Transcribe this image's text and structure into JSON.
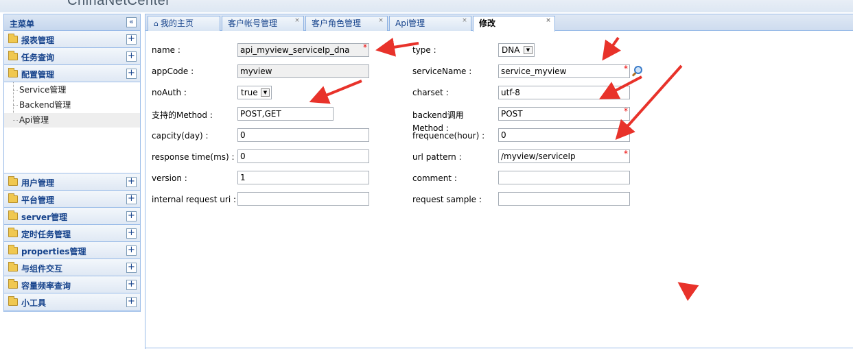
{
  "brand": "ChinaNetCenter",
  "sidebar": {
    "title": "主菜单",
    "collapse_glyph": "«",
    "groups_top": [
      {
        "label": "报表管理"
      },
      {
        "label": "任务查询"
      },
      {
        "label": "配置管理"
      }
    ],
    "sub_items": [
      {
        "label": "Service管理"
      },
      {
        "label": "Backend管理"
      },
      {
        "label": "Api管理"
      }
    ],
    "groups_bottom": [
      {
        "label": "用户管理"
      },
      {
        "label": "平台管理"
      },
      {
        "label": "server管理"
      },
      {
        "label": "定时任务管理"
      },
      {
        "label": "properties管理"
      },
      {
        "label": "与组件交互"
      },
      {
        "label": "容量频率查询"
      },
      {
        "label": "小工具"
      }
    ],
    "plus_glyph": "+"
  },
  "tabs": [
    {
      "label": "我的主页",
      "home_glyph": "⌂"
    },
    {
      "label": "客户帐号管理",
      "close": "×"
    },
    {
      "label": "客户角色管理",
      "close": "×"
    },
    {
      "label": "Api管理",
      "close": "×"
    },
    {
      "label": "修改",
      "close": "×"
    }
  ],
  "form": {
    "left": [
      {
        "label": "name :",
        "value": "api_myview_serviceIp_dna",
        "required": "*"
      },
      {
        "label": "appCode :",
        "value": "myview"
      },
      {
        "label": "noAuth :",
        "value": "true",
        "arrow": "▼"
      },
      {
        "label": "支持的Method :",
        "value": "POST,GET"
      },
      {
        "label": "capcity(day) :",
        "value": "0"
      },
      {
        "label": "response time(ms) :",
        "value": "0"
      },
      {
        "label": "version :",
        "value": "1"
      },
      {
        "label": "internal request uri :",
        "value": ""
      }
    ],
    "right": [
      {
        "label": "type :",
        "value": "DNA",
        "arrow": "▼"
      },
      {
        "label": "serviceName :",
        "value": "service_myview",
        "required": "*"
      },
      {
        "label": "charset :",
        "value": "utf-8"
      },
      {
        "label": "backend调用",
        "value": "POST",
        "required": "*"
      },
      {
        "label_line1": "Method :",
        "label_line2": "frequence(hour) :",
        "value": "0"
      },
      {
        "label": "url pattern :",
        "value": "/myview/serviceIp",
        "required": "*"
      },
      {
        "label": "comment :",
        "value": ""
      },
      {
        "label": "request sample :",
        "value": ""
      }
    ]
  },
  "colors": {
    "arrow_red": "#e8322a",
    "header_blue": "#15428b",
    "border_blue": "#99bbe8"
  }
}
